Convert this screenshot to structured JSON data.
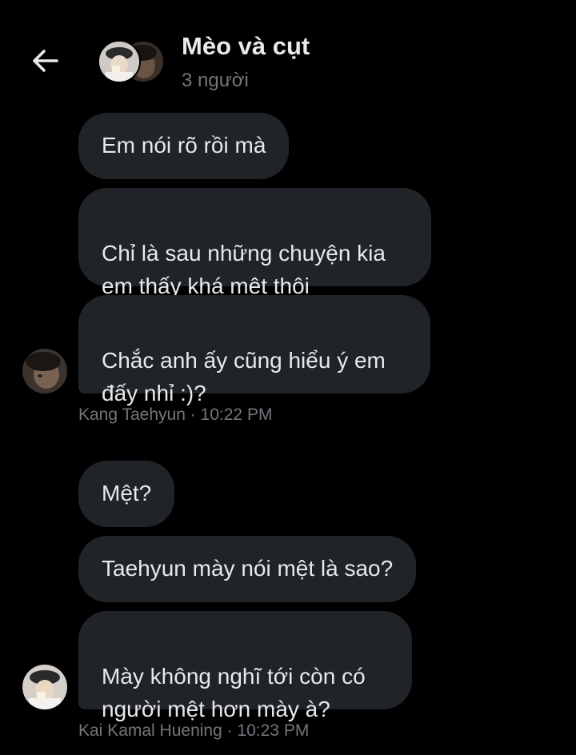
{
  "header": {
    "back_icon": "arrow-left-icon",
    "title": "Mèo và cụt",
    "subtitle": "3 người"
  },
  "messages": [
    {
      "text": "Em nói rõ rồi mà"
    },
    {
      "text": "Chỉ là sau những chuyện kia\nem thấy khá mệt thôi"
    },
    {
      "text": "Chắc anh ấy cũng hiểu ý em\nđấy nhỉ :)?"
    },
    {
      "text": "Mệt?"
    },
    {
      "text": "Taehyun mày nói mệt là sao?"
    },
    {
      "text": "Mày không nghĩ tới còn có\nngười mệt hơn mày à?"
    }
  ],
  "groups": [
    {
      "meta": "Kang Taehyun · 10:22 PM"
    },
    {
      "meta": "Kai Kamal Huening · 10:23 PM"
    }
  ],
  "colors": {
    "background": "#000000",
    "bubble": "#202327",
    "text": "#e7e9ea",
    "muted": "#71767b"
  }
}
